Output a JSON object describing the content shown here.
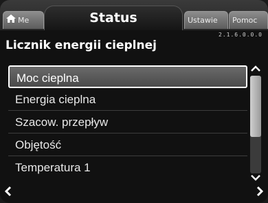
{
  "tabs": {
    "home_label": "Me",
    "active_label": "Status",
    "settings_label": "Ustawie",
    "help_label": "Pomoc"
  },
  "version": "2.1.6.0.0.0",
  "page_title": "Licznik energii cieplnej",
  "list": {
    "items": [
      {
        "label": "Moc cieplna",
        "selected": true
      },
      {
        "label": "Energia cieplna",
        "selected": false
      },
      {
        "label": "Szacow. przepływ",
        "selected": false
      },
      {
        "label": "Objętość",
        "selected": false
      },
      {
        "label": "Temperatura 1",
        "selected": false
      }
    ]
  },
  "icons": {
    "home": "home-icon",
    "scroll_up": "chevron-up-icon",
    "scroll_down": "chevron-down-icon",
    "nav_back": "chevron-left-icon",
    "nav_forward": "chevron-right-icon"
  },
  "scroll": {
    "position_fraction": 0.0,
    "visible_fraction": 0.63
  }
}
